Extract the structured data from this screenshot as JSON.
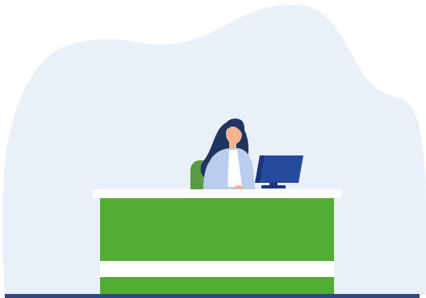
{
  "illustration": {
    "subject": "receptionist-at-desk",
    "icons": [
      "woman-receptionist-icon",
      "computer-monitor-icon",
      "office-chair-icon",
      "reception-desk-icon"
    ]
  },
  "colors": {
    "page_background": "#ffffff",
    "backdrop_blob": "#eaf0f9",
    "desk_green": "#52ad34",
    "desk_top": "#ffffff",
    "desk_stripe": "#ffffff",
    "floor_line": "#2f4784",
    "chair": "#5a9a42",
    "hair": "#1f3460",
    "skin": "#f6b48e",
    "jacket": "#b9cdef",
    "blouse": "#ffffff",
    "monitor": "#264a9c",
    "monitor_dark": "#1a3677"
  }
}
